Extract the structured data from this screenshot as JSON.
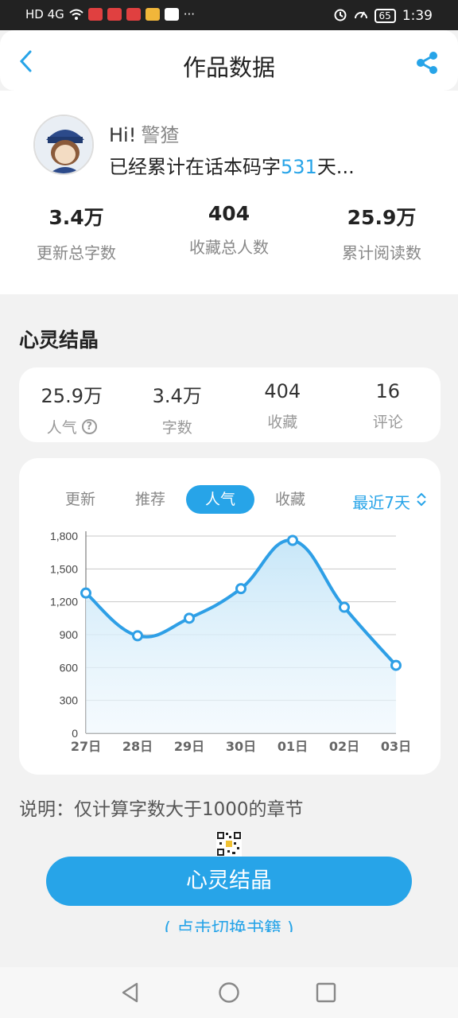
{
  "status_bar": {
    "left_text": "HD 4G",
    "battery": "65",
    "time": "1:39"
  },
  "header": {
    "title": "作品数据"
  },
  "profile": {
    "greeting": "Hi!",
    "name": "警猹",
    "days_prefix": "已经累计在话本码字",
    "days": "531",
    "days_suffix": "天...",
    "stats": [
      {
        "value": "3.4万",
        "label": "更新总字数"
      },
      {
        "value": "404",
        "label": "收藏总人数"
      },
      {
        "value": "25.9万",
        "label": "累计阅读数"
      }
    ]
  },
  "section": {
    "title": "心灵结晶"
  },
  "book_stats": [
    {
      "value": "25.9万",
      "label": "人气"
    },
    {
      "value": "3.4万",
      "label": "字数"
    },
    {
      "value": "404",
      "label": "收藏"
    },
    {
      "value": "16",
      "label": "评论"
    }
  ],
  "chart_tabs": [
    "更新",
    "推荐",
    "人气",
    "收藏"
  ],
  "active_tab": "人气",
  "range": "最近7天",
  "chart_data": {
    "type": "area",
    "categories": [
      "27日",
      "28日",
      "29日",
      "30日",
      "01日",
      "02日",
      "03日"
    ],
    "series": [
      {
        "values": [
          1280,
          890,
          1050,
          1320,
          1760,
          1150,
          620
        ]
      }
    ],
    "ylim": [
      0,
      1800
    ],
    "yticks": [
      "0",
      "300",
      "600",
      "900",
      "1,200",
      "1,500",
      "1,800"
    ],
    "grid": true,
    "colors": {
      "line": "#2e9fe6",
      "fill": "#c8e7f8"
    }
  },
  "note": "说明：仅计算字数大于1000的章节",
  "crystal_button": "心灵结晶",
  "switch_link": "( 点击切换书籍 )",
  "colors": {
    "accent": "#27a4e8"
  }
}
